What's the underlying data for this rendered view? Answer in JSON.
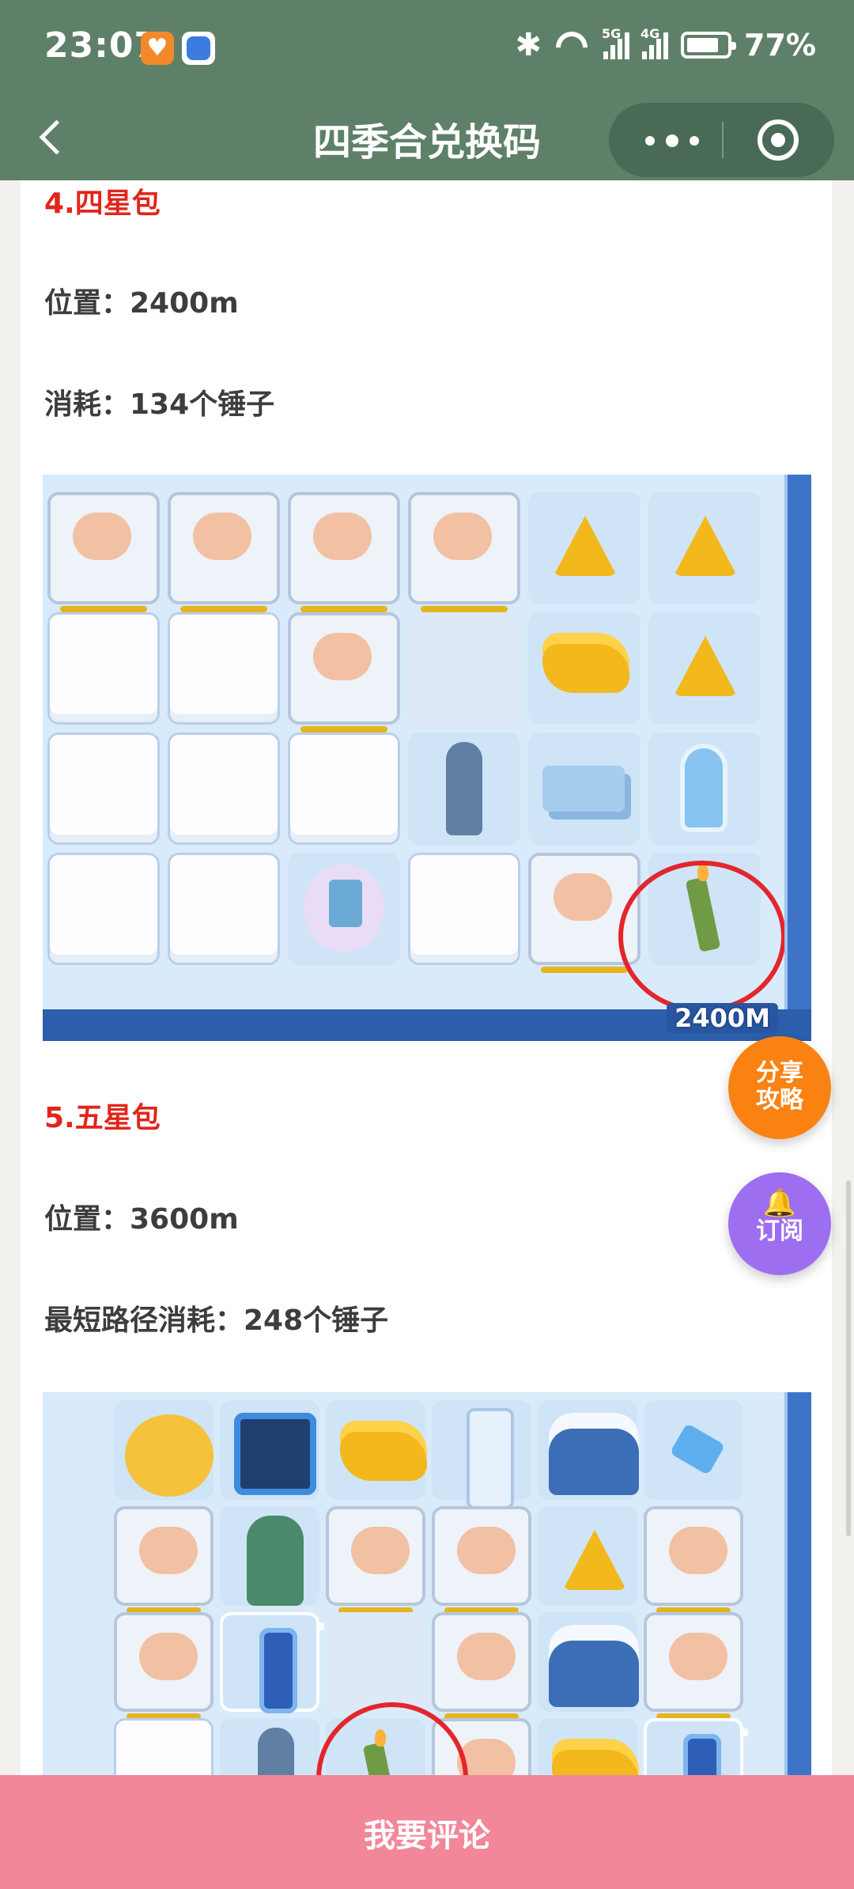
{
  "status_bar": {
    "time": "23:07",
    "signal1": "5G",
    "signal2": "4G",
    "battery": "77%"
  },
  "navbar": {
    "title": "四季合兑换码"
  },
  "article": {
    "s4_title": "4.四星包",
    "s4_location": "位置：2400m",
    "s4_cost": "消耗：134个锤子",
    "s4_distance": "2400M",
    "s5_title": "5.五星包",
    "s5_location": "位置：3600m",
    "s5_cost": "最短路径消耗：248个锤子"
  },
  "floating": {
    "share_line1": "分享",
    "share_line2": "攻略",
    "subscribe": "订阅"
  },
  "bottom": {
    "comment": "我要评论"
  },
  "colors": {
    "header": "#5f8068",
    "section_title": "#e1251b",
    "share": "#fa8212",
    "subscribe": "#9d6ef0",
    "bottom_bar": "#f2879a"
  }
}
